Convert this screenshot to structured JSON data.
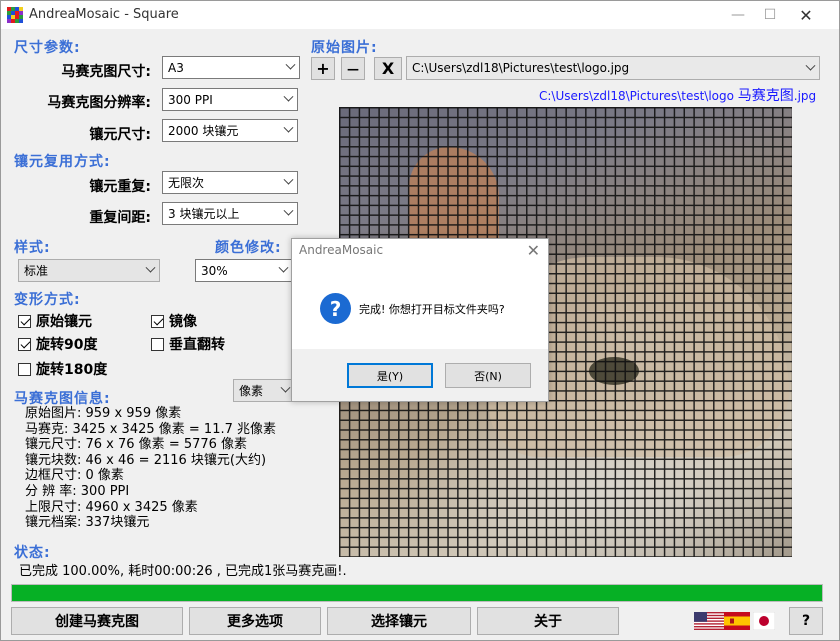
{
  "window": {
    "title": "AndreaMosaic - Square",
    "icon_colors": [
      "#e21b1b",
      "#2a9d3b",
      "#1f4fd8",
      "#f2d01c",
      "#2a9d3b",
      "#1f4fd8",
      "#e21b1b",
      "#8b2fc9",
      "#1f4fd8",
      "#f2d01c",
      "#e21b1b",
      "#2a9d3b",
      "#8b2fc9",
      "#e21b1b",
      "#2a9d3b",
      "#1f4fd8"
    ],
    "minimize": "—",
    "maximize": "☐",
    "close": "✕"
  },
  "size_params": {
    "section_label": "尺寸参数:",
    "mosaic_size_label": "马赛克图尺寸:",
    "mosaic_size_value": "A3",
    "resolution_label": "马赛克图分辨率:",
    "resolution_value": "300 PPI",
    "tile_size_label": "镶元尺寸:",
    "tile_size_value": "2000 块镶元"
  },
  "reuse": {
    "section_label": "镶元复用方式:",
    "repeat_label": "镶元重复:",
    "repeat_value": "无限次",
    "distance_label": "重复间距:",
    "distance_value": "3  块镶元以上"
  },
  "style": {
    "section_label": "样式:",
    "value": "标准",
    "color_label": "颜色修改:",
    "color_value": "30%"
  },
  "transform": {
    "section_label": "变形方式:",
    "options": [
      {
        "label": "原始镶元",
        "checked": true
      },
      {
        "label": "镜像",
        "checked": true
      },
      {
        "label": "旋转90度",
        "checked": true
      },
      {
        "label": "垂直翻转",
        "checked": false
      },
      {
        "label": "旋转180度",
        "checked": false
      }
    ]
  },
  "mosaic_info": {
    "section_label": "马赛克图信息:",
    "unit_value": "像素",
    "lines": [
      "原始图片: 959 x 959 像素",
      "马赛克: 3425 x 3425 像素 = 11.7 兆像素",
      "镶元尺寸: 76 x 76 像素 = 5776 像素",
      "镶元块数: 46 x 46 = 2116 块镶元(大约)",
      "边框尺寸: 0 像素",
      "分 辨 率: 300 PPI",
      "上限尺寸: 4960 x 3425 像素",
      "镶元档案: 337块镶元"
    ]
  },
  "source": {
    "section_label": "原始图片:",
    "add": "+",
    "remove": "—",
    "clear": "X",
    "path": "C:\\Users\\zdl18\\Pictures\\test\\logo.jpg",
    "output_path_prefix": "C:\\Users\\zdl18\\Pictures\\test\\logo ",
    "output_path_suffix": "马赛克图",
    "output_path_ext": ".jpg"
  },
  "status": {
    "section_label": "状态:",
    "text": "已完成 100.00%, 耗时00:00:26 ,  已完成1张马赛克画!.",
    "progress": 1.0,
    "progress_color": "#06b025"
  },
  "buttons": {
    "create": "创建马赛克图",
    "more": "更多选项",
    "select_tiles": "选择镶元",
    "about": "关于",
    "help": "?"
  },
  "dialog": {
    "title": "AndreaMosaic",
    "close": "✕",
    "icon": "?",
    "message": "完成! 你想打开目标文件夹吗?",
    "yes": "是(Y)",
    "no": "否(N)"
  },
  "colors": {
    "section_blue": "#3b6fd6",
    "link_blue": "#1a1aff"
  }
}
